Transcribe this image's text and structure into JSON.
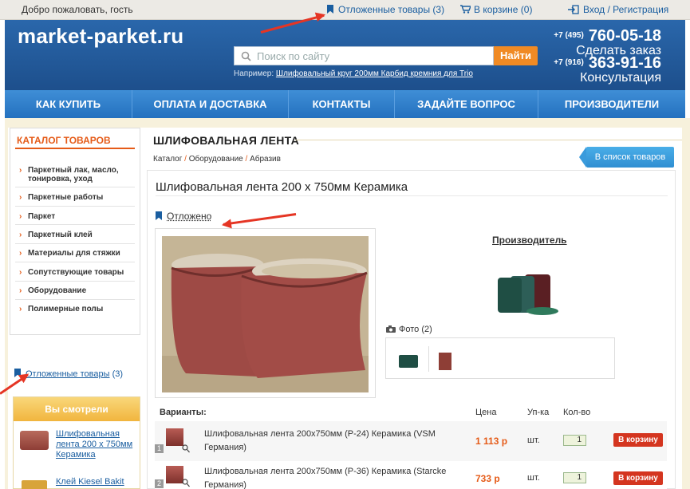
{
  "topbar": {
    "greeting": "Добро пожаловать, гость",
    "deferred_label": "Отложенные товары (3)",
    "cart_label": "В корзине (0)",
    "login_label": "Вход / Регистрация"
  },
  "header": {
    "logo": "market-parket.ru",
    "search_placeholder": "Поиск по сайту",
    "search_button": "Найти",
    "example_prefix": "Например:",
    "example_link": "Шлифовальный круг 200мм Карбид кремния для Trio",
    "phone1_code": "+7 (495)",
    "phone1_number": "760-05-18",
    "phone1_caption": "Сделать заказ",
    "phone2_code": "+7 (916)",
    "phone2_number": "363-91-16",
    "phone2_caption": "Консультация"
  },
  "nav": [
    "КАК КУПИТЬ",
    "ОПЛАТА И ДОСТАВКА",
    "КОНТАКТЫ",
    "ЗАДАЙТЕ ВОПРОС",
    "ПРОИЗВОДИТЕЛИ"
  ],
  "sidebar": {
    "catalog_title": "КАТАЛОГ ТОВАРОВ",
    "items": [
      "Паркетный лак, масло, тонировка, уход",
      "Паркетные работы",
      "Паркет",
      "Паркетный клей",
      "Материалы для стяжки",
      "Сопутствующие товары",
      "Оборудование",
      "Полимерные полы"
    ],
    "deferred_link": "Отложенные товары",
    "deferred_count": "(3)",
    "seen_title": "Вы смотрели",
    "seen_items": [
      "Шлифовальная лента 200 х 750мм Керамика",
      "Клей Kiesel Bakit"
    ]
  },
  "main": {
    "section_title": "ШЛИФОВАЛЬНАЯ ЛЕНТА",
    "breadcrumb": [
      "Каталог",
      "Оборудование",
      "Абразив"
    ],
    "back_button": "В список товаров",
    "product_title": "Шлифовальная лента 200 х 750мм Керамика",
    "deferred_label": "Отложено",
    "manufacturer_label": "Производитель",
    "photo_label": "Фото (2)",
    "variants_label": "Варианты:",
    "col_price": "Цена",
    "col_unit": "Уп-ка",
    "col_qty": "Кол-во",
    "variants": [
      {
        "num": "1",
        "name": "Шлифовальная лента 200x750мм (P-24) Керамика (VSM Германия)",
        "price": "1 113 р",
        "unit": "шт.",
        "qty": "1",
        "button": "В корзину"
      },
      {
        "num": "2",
        "name": "Шлифовальная лента 200x750мм (P-36) Керамика (Starcke Германия)",
        "price": "733 р",
        "unit": "шт.",
        "qty": "1",
        "button": "В корзину"
      }
    ]
  },
  "colors": {
    "brand_blue": "#1d4f8c",
    "nav_blue": "#2f7fcc",
    "accent_orange": "#f08a24",
    "cart_red": "#d4351f",
    "arrow_red": "#e53524"
  }
}
